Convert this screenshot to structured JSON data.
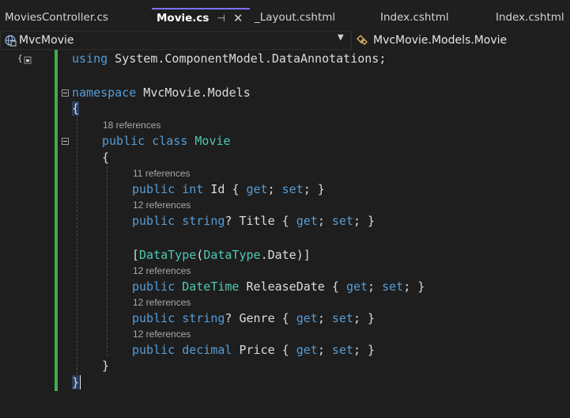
{
  "tabs": [
    {
      "label": "MoviesController.cs",
      "active": false
    },
    {
      "label": "Movie.cs",
      "active": true,
      "pin_icon": "pin-icon",
      "close_icon": "close-icon"
    },
    {
      "label": "_Layout.cshtml",
      "active": false
    },
    {
      "label": "Index.cshtml",
      "active": false
    },
    {
      "label": "Index.cshtml",
      "active": false
    }
  ],
  "navbar": {
    "project": "MvcMovie",
    "member": "MvcMovie.Models.Movie",
    "project_icon": "globe-project-icon",
    "member_icon": "class-icon",
    "dropdown_icon": "chevron-down-icon"
  },
  "code": {
    "line_using": {
      "kw": "using",
      "rest": " System.ComponentModel.DataAnnotations;"
    },
    "line_namespace": {
      "kw": "namespace",
      "rest": " MvcMovie.Models"
    },
    "brace_open": "{",
    "lens_class": "18 references",
    "line_class": {
      "kw1": "public",
      "kw2": "class",
      "name": "Movie"
    },
    "class_brace_open": "{",
    "lens_id": "11 references",
    "line_id": {
      "kw1": "public",
      "type": "int",
      "name": " Id ",
      "b1": "{ ",
      "get": "get",
      "s1": "; ",
      "set": "set",
      "s2": "; }"
    },
    "lens_title": "12 references",
    "line_title": {
      "kw1": "public",
      "type": "string",
      "q": "?",
      "name": " Title ",
      "b1": "{ ",
      "get": "get",
      "s1": "; ",
      "set": "set",
      "s2": "; }"
    },
    "line_attr": {
      "open": "[",
      "attr": "DataType",
      "p1": "(",
      "enum": "DataType",
      "dot": ".",
      "member": "Date",
      "close": ")]"
    },
    "lens_release": "12 references",
    "line_release": {
      "kw1": "public",
      "type": "DateTime",
      "name": " ReleaseDate ",
      "b1": "{ ",
      "get": "get",
      "s1": "; ",
      "set": "set",
      "s2": "; }"
    },
    "lens_genre": "12 references",
    "line_genre": {
      "kw1": "public",
      "type": "string",
      "q": "?",
      "name": " Genre ",
      "b1": "{ ",
      "get": "get",
      "s1": "; ",
      "set": "set",
      "s2": "; }"
    },
    "lens_price": "12 references",
    "line_price": {
      "kw1": "public",
      "type": "decimal",
      "name": " Price ",
      "b1": "{ ",
      "get": "get",
      "s1": "; ",
      "set": "set",
      "s2": "; }"
    },
    "class_brace_close": "}",
    "brace_close": "}"
  },
  "colors": {
    "keyword": "#569cd6",
    "type": "#4ec9b0",
    "text": "#dcdcdc",
    "lens": "#a8a8a8",
    "change_bar": "#3fae4a",
    "active_tab_border": "#7b73ff"
  }
}
